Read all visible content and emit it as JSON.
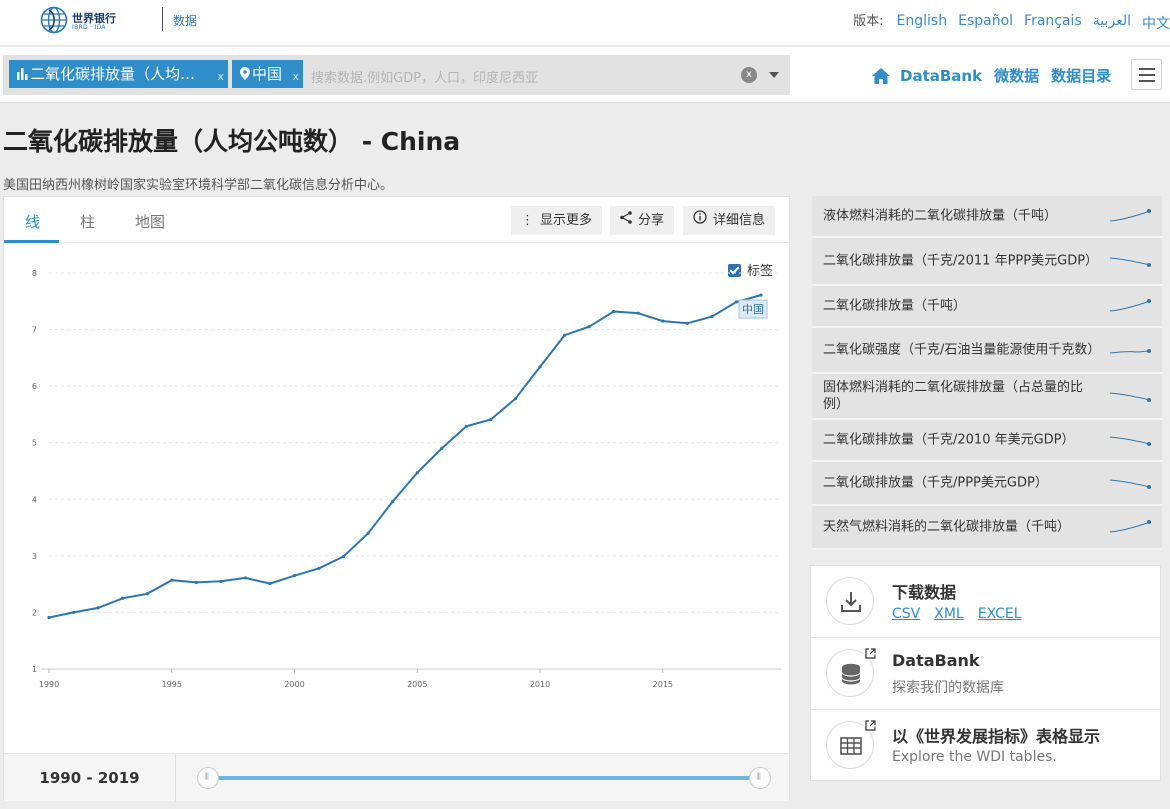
{
  "header": {
    "logo_title": "世界银行",
    "logo_sub": "IBRD · IDA",
    "section": "数据",
    "lang_label": "版本:",
    "languages": [
      "English",
      "Español",
      "Français",
      "العربية",
      "中文"
    ]
  },
  "search": {
    "chip_indicator": "二氧化碳排放量（人均…",
    "chip_country": "中国",
    "chip_remove": "x",
    "placeholder": "搜索数据.例如GDP，人口，印度尼西亚",
    "clear": "x"
  },
  "nav": {
    "databank": "DataBank",
    "microdata": "微数据",
    "catalog": "数据目录"
  },
  "page": {
    "title": "二氧化碳排放量（人均公吨数） - China",
    "source": "美国田纳西州橡树岭国家实验室环境科学部二氧化碳信息分析中心。"
  },
  "tabs": [
    "线",
    "柱",
    "地图"
  ],
  "toolbar": {
    "more": "显示更多",
    "share": "分享",
    "details": "详细信息"
  },
  "label_toggle": "标签",
  "range_label": "1990 - 2019",
  "chart_data": {
    "type": "line",
    "series": [
      {
        "name": "中国",
        "x": [
          1990,
          1991,
          1992,
          1993,
          1994,
          1995,
          1996,
          1997,
          1998,
          1999,
          2000,
          2001,
          2002,
          2003,
          2004,
          2005,
          2006,
          2007,
          2008,
          2009,
          2010,
          2011,
          2012,
          2013,
          2014,
          2015,
          2016,
          2017,
          2018,
          2019
        ],
        "values": [
          1.91,
          2.0,
          2.08,
          2.25,
          2.33,
          2.57,
          2.53,
          2.55,
          2.61,
          2.51,
          2.65,
          2.78,
          2.99,
          3.4,
          3.96,
          4.47,
          4.9,
          5.29,
          5.41,
          5.78,
          6.34,
          6.9,
          7.05,
          7.32,
          7.29,
          7.15,
          7.11,
          7.23,
          7.49,
          7.61
        ]
      }
    ],
    "xticks": [
      1990,
      1995,
      2000,
      2005,
      2010,
      2015
    ],
    "yticks": [
      1,
      2,
      3,
      4,
      5,
      6,
      7,
      8
    ],
    "xlim": [
      1990,
      2019
    ],
    "ylim": [
      1,
      8
    ],
    "grid": true,
    "color": "#2c75ad"
  },
  "related": [
    {
      "label": "液体燃料消耗的二氧化碳排放量（千吨）",
      "trend": "up"
    },
    {
      "label": "二氧化碳排放量（千克/2011 年PPP美元GDP）",
      "trend": "down"
    },
    {
      "label": "二氧化碳排放量（千吨）",
      "trend": "up"
    },
    {
      "label": "二氧化碳强度（千克/石油当量能源使用千克数）",
      "trend": "flat"
    },
    {
      "label": "固体燃料消耗的二氧化碳排放量（占总量的比例）",
      "trend": "down"
    },
    {
      "label": "二氧化碳排放量（千克/2010 年美元GDP）",
      "trend": "down"
    },
    {
      "label": "二氧化碳排放量（千克/PPP美元GDP）",
      "trend": "down"
    },
    {
      "label": "天然气燃料消耗的二氧化碳排放量（千吨）",
      "trend": "up"
    }
  ],
  "cards": {
    "download": {
      "title": "下载数据",
      "links": [
        "CSV",
        "XML",
        "EXCEL"
      ]
    },
    "databank": {
      "title": "DataBank",
      "sub": "探索我们的数据库"
    },
    "wdi": {
      "title": "以《世界发展指标》表格显示",
      "sub": "Explore the WDI tables."
    }
  },
  "colors": {
    "accent": "#2f8ec9",
    "line": "#2c75ad",
    "chip": "#2f8ec9"
  }
}
